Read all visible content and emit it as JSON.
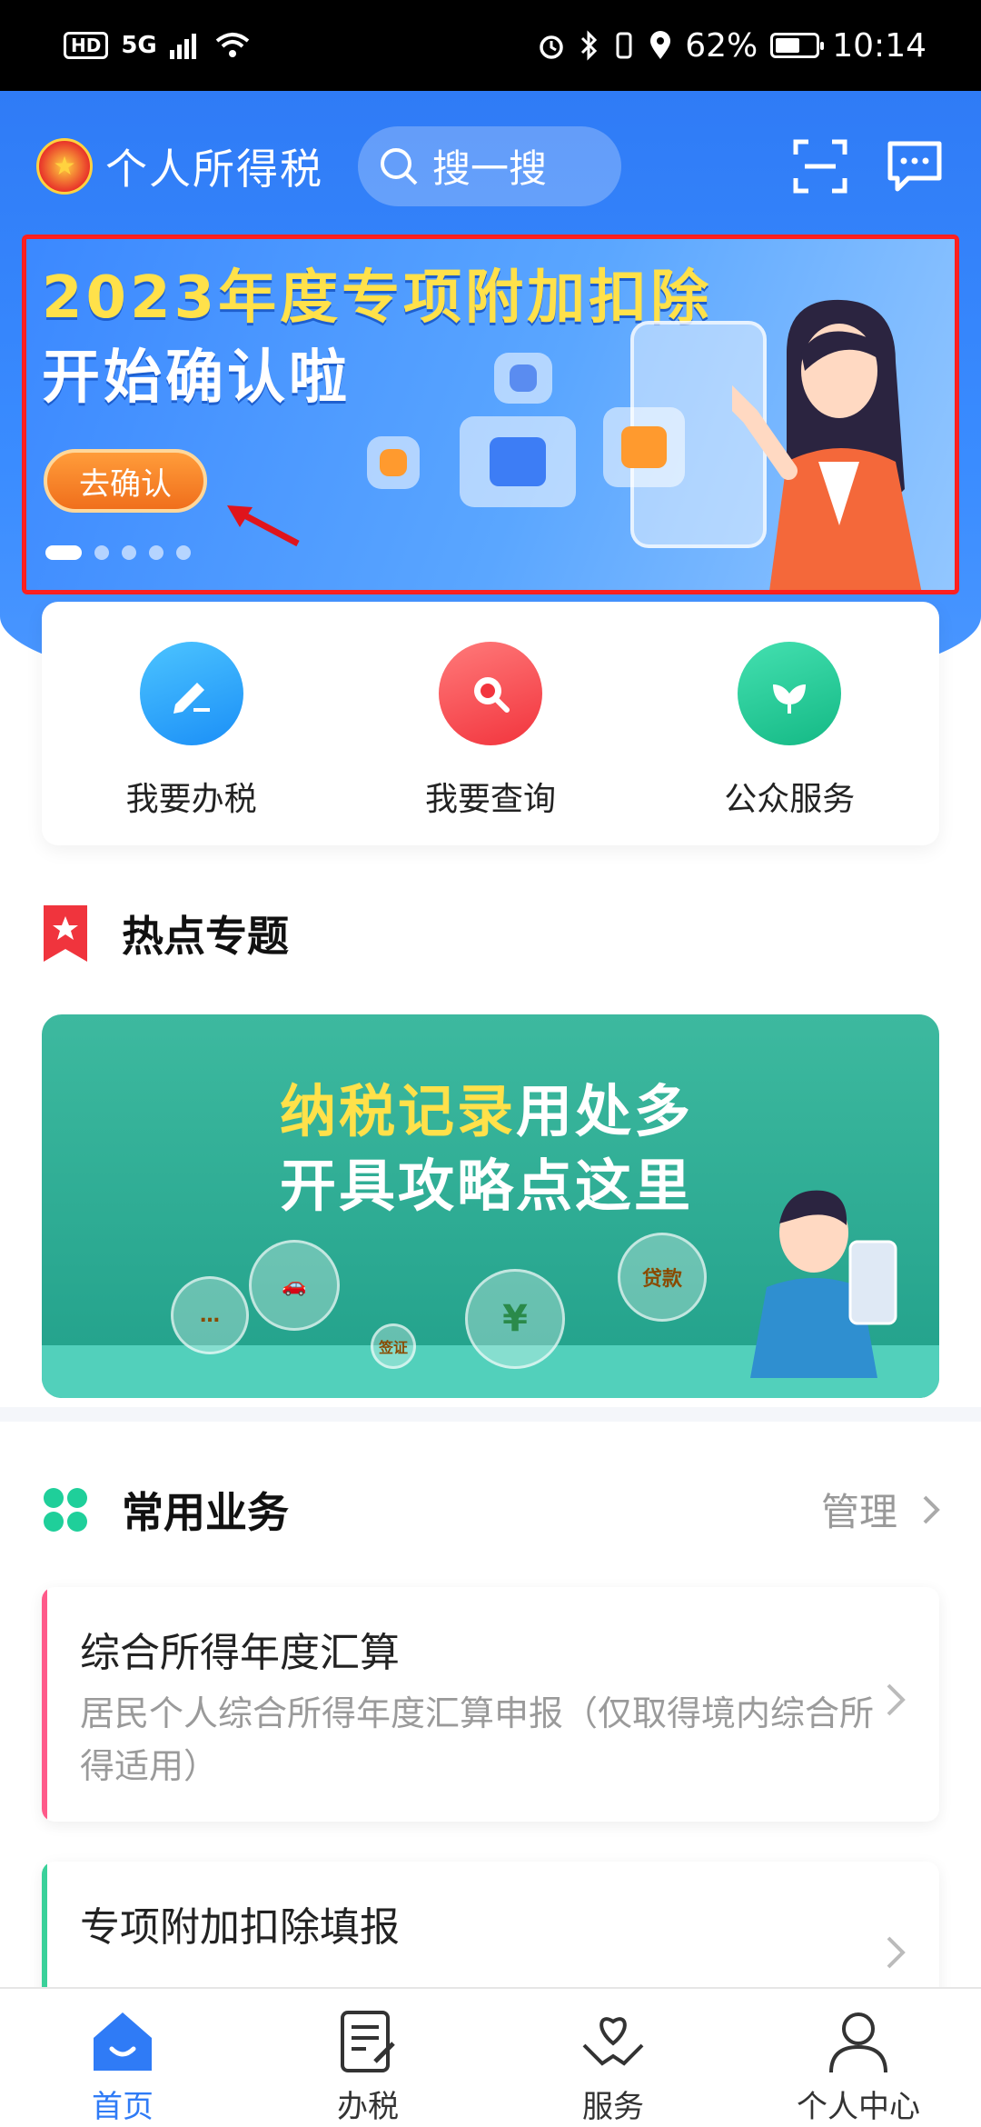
{
  "status_bar": {
    "hd": "HD",
    "network": "5G",
    "battery": "62%",
    "battery_level": 0.62,
    "time": "10:14"
  },
  "header": {
    "app_title": "个人所得税",
    "search_placeholder": "搜一搜",
    "icons": [
      "scan-icon",
      "message-icon"
    ]
  },
  "banner": {
    "title_line1": "2023年度专项附加扣除",
    "title_line2": "开始确认啦",
    "button_label": "去确认",
    "slides_total": 5,
    "active_slide": 1
  },
  "quick_actions": [
    {
      "label": "我要办税",
      "icon": "edit-icon",
      "color": "#1fa8ff"
    },
    {
      "label": "我要查询",
      "icon": "search-icon",
      "color": "#ff4a4a"
    },
    {
      "label": "公众服务",
      "icon": "flower-icon",
      "color": "#1fcf9a"
    }
  ],
  "hot_topics": {
    "title": "热点专题",
    "banner_line1_highlight": "纳税记录",
    "banner_line1_rest": "用处多",
    "banner_line2": "开具攻略点这里",
    "bubbles": [
      "贷款",
      "签证",
      "¥"
    ]
  },
  "common_business": {
    "title": "常用业务",
    "manage_label": "管理",
    "items": [
      {
        "title": "综合所得年度汇算",
        "desc": "居民个人综合所得年度汇算申报（仅取得境内综合所得适用）",
        "accent": "#ff5a8a"
      },
      {
        "title": "专项附加扣除填报",
        "desc": "",
        "accent": "#3ad19a"
      }
    ]
  },
  "bottom_nav": [
    {
      "label": "首页",
      "icon": "home-icon",
      "active": true
    },
    {
      "label": "办税",
      "icon": "document-icon",
      "active": false
    },
    {
      "label": "服务",
      "icon": "heart-hands-icon",
      "active": false
    },
    {
      "label": "个人中心",
      "icon": "user-icon",
      "active": false
    }
  ],
  "colors": {
    "primary": "#2f7bf6",
    "highlight_frame": "#ff1f1f",
    "banner_yellow": "#ffe14a"
  }
}
